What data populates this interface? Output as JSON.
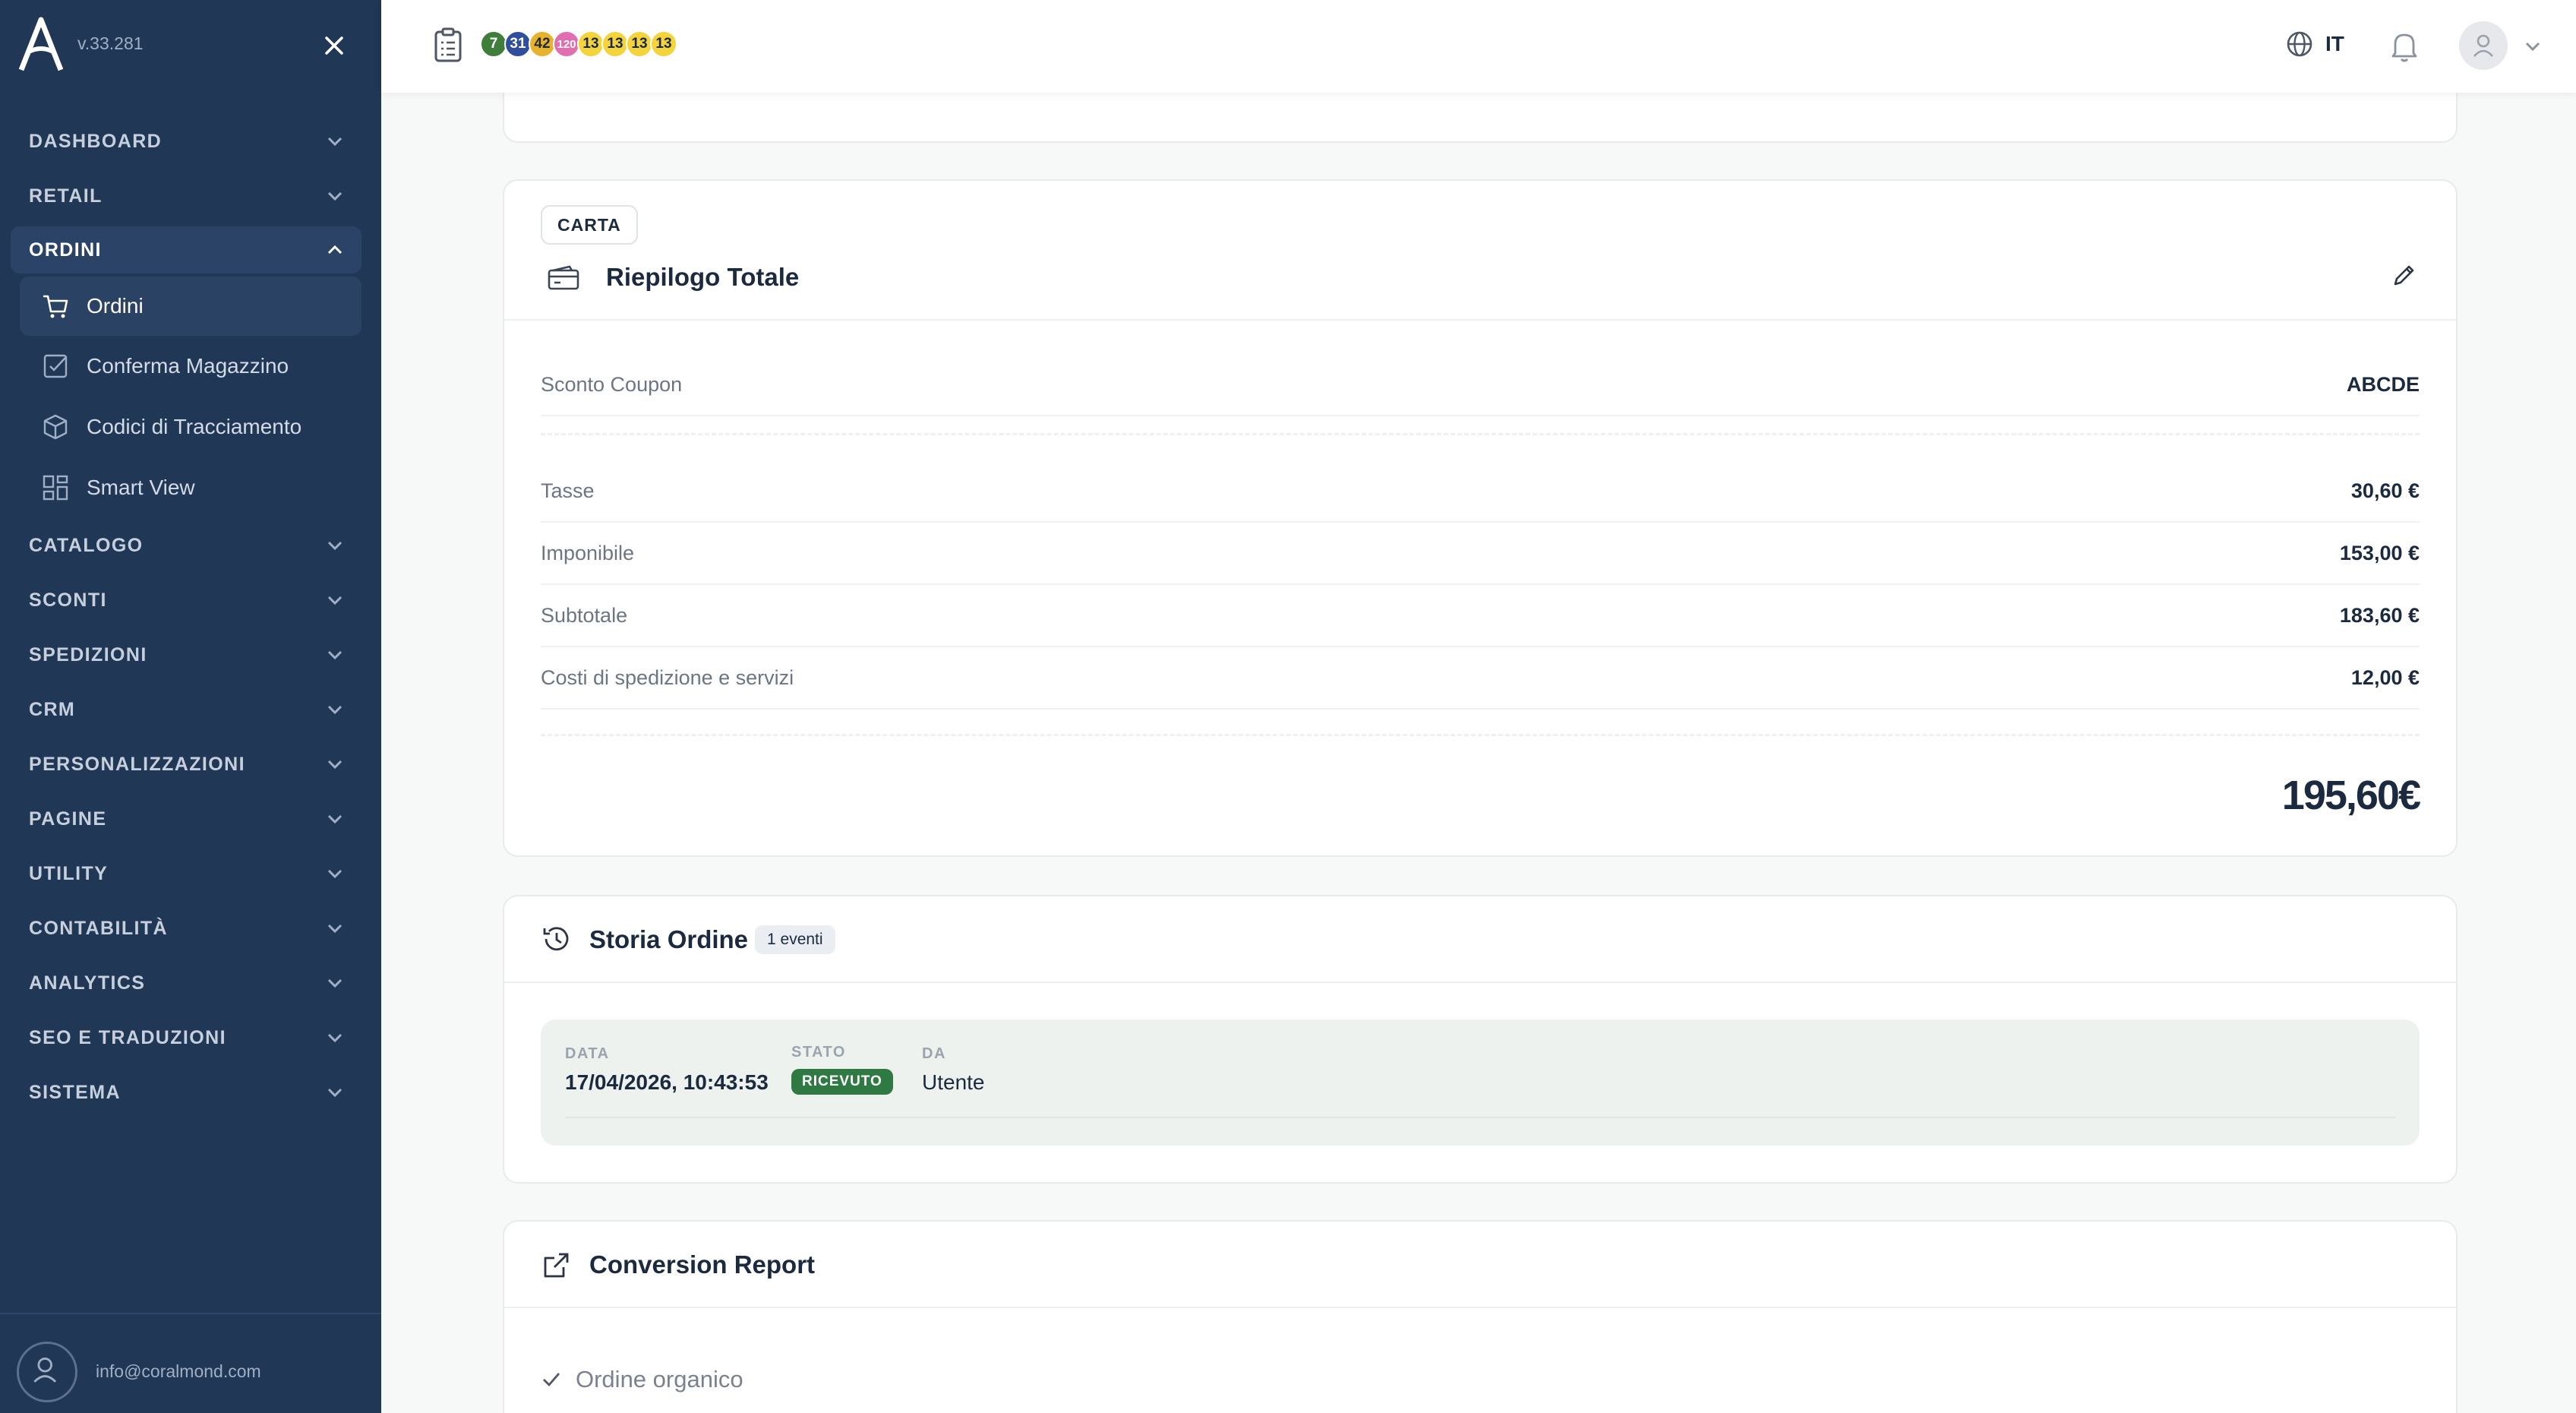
{
  "sidebar": {
    "version": "v.33.281",
    "sections": [
      {
        "label": "DASHBOARD"
      },
      {
        "label": "RETAIL"
      },
      {
        "label": "ORDINI"
      },
      {
        "label": "CATALOGO"
      },
      {
        "label": "SCONTI"
      },
      {
        "label": "SPEDIZIONI"
      },
      {
        "label": "CRM"
      },
      {
        "label": "PERSONALIZZAZIONI"
      },
      {
        "label": "PAGINE"
      },
      {
        "label": "UTILITY"
      },
      {
        "label": "CONTABILITÀ"
      },
      {
        "label": "ANALYTICS"
      },
      {
        "label": "SEO E TRADUZIONI"
      },
      {
        "label": "SISTEMA"
      }
    ],
    "ordini_items": [
      {
        "label": "Ordini",
        "icon": "cart-icon"
      },
      {
        "label": "Conferma Magazzino",
        "icon": "checkbox-icon"
      },
      {
        "label": "Codici di Tracciamento",
        "icon": "box-icon"
      },
      {
        "label": "Smart View",
        "icon": "grid-icon"
      }
    ],
    "user_email": "info@coralmond.com"
  },
  "topbar": {
    "badges": [
      {
        "value": "7",
        "color": "#3f7d3a",
        "text": "#ffffff"
      },
      {
        "value": "31",
        "color": "#2f4f9e",
        "text": "#ffffff"
      },
      {
        "value": "42",
        "color": "#e8b32c",
        "text": "#1c2a40"
      },
      {
        "value": "120",
        "color": "#e26db0",
        "text": "#ffffff"
      },
      {
        "value": "13",
        "color": "#f4d33c",
        "text": "#1c2a40"
      },
      {
        "value": "13",
        "color": "#f4d33c",
        "text": "#1c2a40"
      },
      {
        "value": "13",
        "color": "#f4d33c",
        "text": "#1c2a40"
      },
      {
        "value": "13",
        "color": "#f4d33c",
        "text": "#1c2a40"
      }
    ],
    "language": "IT"
  },
  "summary": {
    "tag": "CARTA",
    "title": "Riepilogo Totale",
    "coupon_label": "Sconto Coupon",
    "coupon_value": "ABCDE",
    "rows": [
      {
        "label": "Tasse",
        "value": "30,60 €"
      },
      {
        "label": "Imponibile",
        "value": "153,00 €"
      },
      {
        "label": "Subtotale",
        "value": "183,60 €"
      },
      {
        "label": "Costi di spedizione e servizi",
        "value": "12,00 €"
      }
    ],
    "total": "195,60€"
  },
  "history": {
    "title": "Storia Ordine",
    "count_badge": "1 eventi",
    "event": {
      "date_label": "DATA",
      "date_value": "17/04/2026, 10:43:53",
      "status_label": "STATO",
      "status_value": "RICEVUTO",
      "by_label": "DA",
      "by_value": "Utente"
    }
  },
  "conversion": {
    "title": "Conversion Report",
    "line": "Ordine organico"
  }
}
